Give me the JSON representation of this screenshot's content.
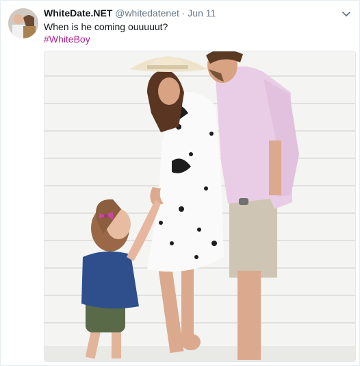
{
  "tweet": {
    "display_name": "WhiteDate.NET",
    "handle": "@whitedatenet",
    "separator": "·",
    "date": "Jun 11",
    "text": "When is he coming ouuuuut?",
    "hashtag": "#WhiteBoy"
  },
  "icons": {
    "menu": "chevron-down-icon",
    "avatar": "profile-photo"
  },
  "colors": {
    "name": "#14171a",
    "meta": "#657786",
    "hashtag": "#b0208b",
    "border": "#e6ecf0"
  },
  "media": {
    "description_kind": "photo"
  }
}
